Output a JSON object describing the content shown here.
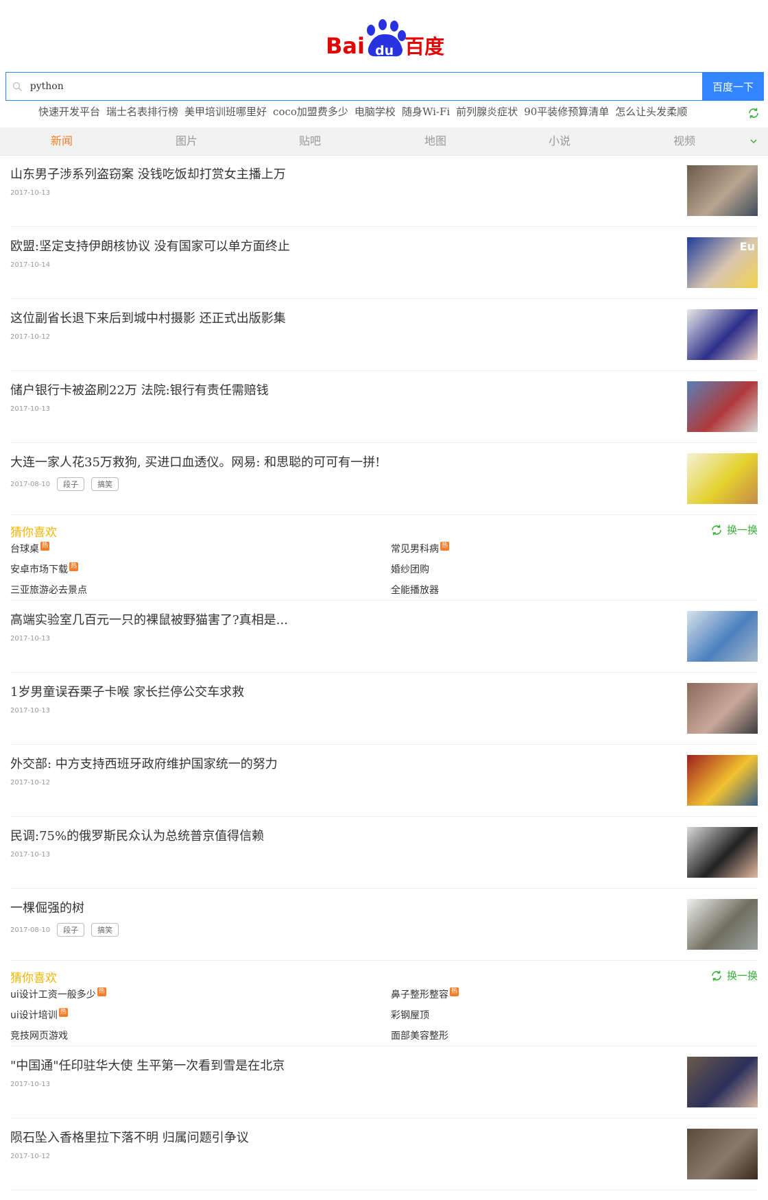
{
  "search": {
    "query": "python",
    "button_label": "百度一下"
  },
  "hot_words": [
    "快速开发平台",
    "瑞士名表排行榜",
    "美甲培训班哪里好",
    "coco加盟费多少",
    "电脑学校",
    "随身Wi-Fi",
    "前列腺炎症状",
    "90平装修预算清单",
    "怎么让头发柔顺"
  ],
  "tabs": [
    "新闻",
    "图片",
    "贴吧",
    "地图",
    "小说",
    "视频"
  ],
  "news": [
    {
      "title": "山东男子涉系列盗窃案 没钱吃饭却打赏女主播上万",
      "date": "2017-10-13",
      "tags": []
    },
    {
      "title": "欧盟:坚定支持伊朗核协议 没有国家可以单方面终止",
      "date": "2017-10-14",
      "tags": [],
      "thumb_text": "Eu"
    },
    {
      "title": "这位副省长退下来后到城中村摄影 还正式出版影集",
      "date": "2017-10-12",
      "tags": []
    },
    {
      "title": "储户银行卡被盗刷22万 法院:银行有责任需赔钱",
      "date": "2017-10-13",
      "tags": []
    },
    {
      "title": "大连一家人花35万救狗, 买进口血透仪。网易: 和思聪的可可有一拼!",
      "date": "2017-08-10",
      "tags": [
        "段子",
        "搞笑"
      ]
    }
  ],
  "guess1": {
    "title": "猜你喜欢",
    "refresh_label": "换一换",
    "items": [
      {
        "label": "台球桌",
        "hot": true
      },
      {
        "label": "常见男科病",
        "hot": true
      },
      {
        "label": "安卓市场下载",
        "hot": true
      },
      {
        "label": "婚纱团购",
        "hot": false
      },
      {
        "label": "三亚旅游必去景点",
        "hot": false
      },
      {
        "label": "全能播放器",
        "hot": false
      }
    ]
  },
  "news2": [
    {
      "title": "高端实验室几百元一只的裸鼠被野猫害了?真相是...",
      "date": "2017-10-13",
      "tags": []
    },
    {
      "title": "1岁男童误吞栗子卡喉 家长拦停公交车求救",
      "date": "2017-10-13",
      "tags": []
    },
    {
      "title": "外交部: 中方支持西班牙政府维护国家统一的努力",
      "date": "2017-10-12",
      "tags": []
    },
    {
      "title": "民调:75%的俄罗斯民众认为总统普京值得信赖",
      "date": "2017-10-13",
      "tags": []
    },
    {
      "title": "一棵倔强的树",
      "date": "2017-08-10",
      "tags": [
        "段子",
        "搞笑"
      ]
    }
  ],
  "guess2": {
    "title": "猜你喜欢",
    "refresh_label": "换一换",
    "items": [
      {
        "label": "ui设计工资一般多少",
        "hot": true
      },
      {
        "label": "鼻子整形整容",
        "hot": true
      },
      {
        "label": "ui设计培训",
        "hot": true
      },
      {
        "label": "彩钢屋顶",
        "hot": false
      },
      {
        "label": "竞技网页游戏",
        "hot": false
      },
      {
        "label": "面部美容整形",
        "hot": false
      }
    ]
  },
  "news3": [
    {
      "title": "\"中国通\"任印驻华大使 生平第一次看到雪是在北京",
      "date": "2017-10-13",
      "tags": []
    },
    {
      "title": "陨石坠入香格里拉下落不明 归属问题引争议",
      "date": "2017-10-12",
      "tags": []
    }
  ],
  "hot_badge": "热",
  "logo_text": {
    "left": "Bai",
    "paw": "du",
    "right": "百度"
  },
  "colors": {
    "accent_blue": "#3385ff",
    "tab_active": "#f77d28",
    "guess_title": "#f7b500",
    "refresh_green": "#38b03a",
    "logo_red": "#e10602",
    "logo_blue": "#2932e1"
  }
}
